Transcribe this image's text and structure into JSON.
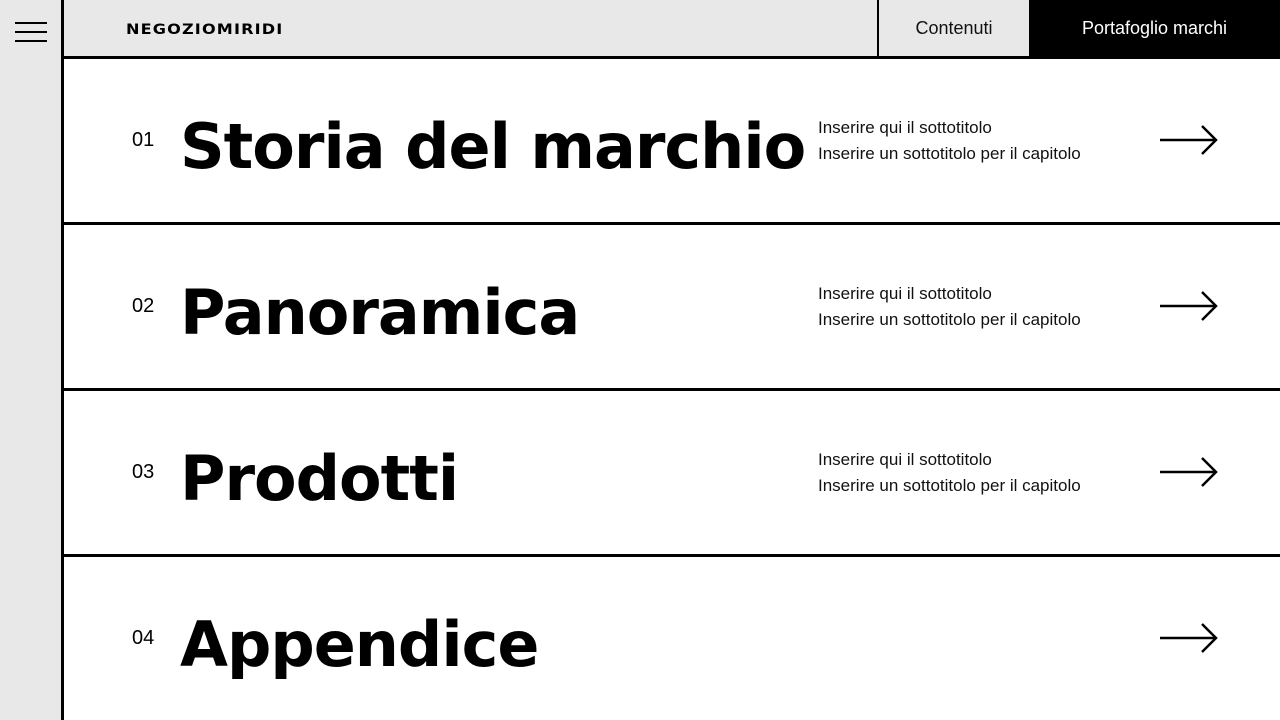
{
  "header": {
    "logo": "NEGOZIOMIRIDI",
    "nav": {
      "contents_label": "Contenuti",
      "portfolio_label": "Portafoglio marchi"
    }
  },
  "rows": [
    {
      "number": "01",
      "title": "Storia del marchio",
      "subtitle_1": "Inserire qui il sottotitolo",
      "subtitle_2": "Inserire un sottotitolo per il capitolo"
    },
    {
      "number": "02",
      "title": "Panoramica",
      "subtitle_1": "Inserire qui il sottotitolo",
      "subtitle_2": "Inserire un sottotitolo per il capitolo"
    },
    {
      "number": "03",
      "title": "Prodotti",
      "subtitle_1": "Inserire qui il sottotitolo",
      "subtitle_2": "Inserire un sottotitolo per il capitolo"
    },
    {
      "number": "04",
      "title": "Appendice"
    }
  ],
  "icons": {
    "menu": "hamburger-icon",
    "row_arrow": "arrow-right-icon"
  },
  "colors": {
    "panel_bg": "#e8e8e8",
    "content_bg": "#ffffff",
    "ink": "#000000",
    "active_nav_bg": "#000000",
    "active_nav_text": "#ffffff"
  }
}
